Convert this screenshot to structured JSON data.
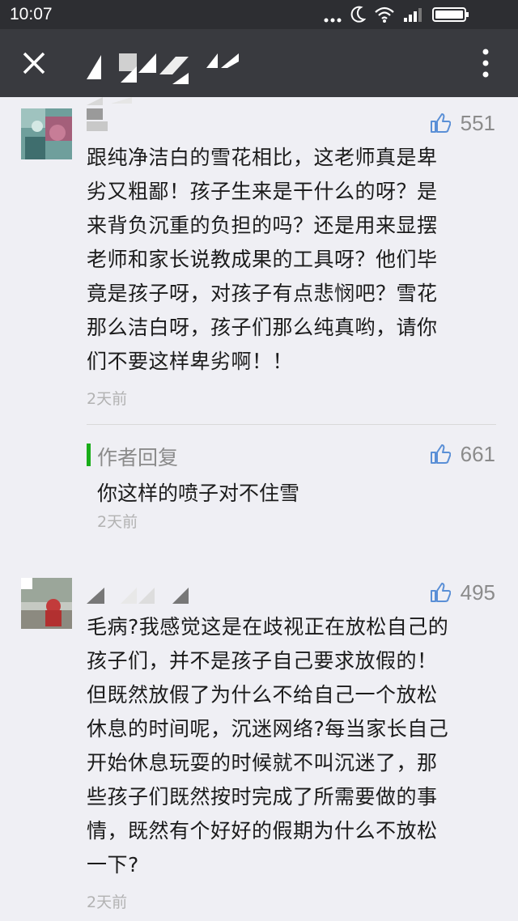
{
  "status_bar": {
    "time": "10:07",
    "icons": [
      "more-dots-icon",
      "moon-icon",
      "wifi-icon",
      "signal-icon",
      "battery-icon"
    ]
  },
  "nav": {
    "close_icon": "close-icon",
    "more_icon": "more-vertical-icon",
    "title_obscured": true
  },
  "colors": {
    "status_bar_bg": "#2d2e32",
    "nav_bg": "#393a3f",
    "page_bg": "#efeff4",
    "reply_accent": "#19ad19",
    "meta_gray": "#8b8b8b"
  },
  "comments": [
    {
      "likes": "551",
      "text": "跟纯净洁白的雪花相比，这老师真是卑劣又粗鄙！孩子生来是干什么的呀？是来背负沉重的负担的吗？还是用来显摆老师和家长说教成果的工具呀？他们毕竟是孩子呀，对孩子有点悲悯吧？雪花那么洁白呀，孩子们那么纯真哟，请你们不要这样卑劣啊！！",
      "lines": [
        "跟纯净洁白的雪花相比，这老师真是卑",
        "劣又粗鄙！孩子生来是干什么的呀？是",
        "来背负沉重的负担的吗？还是用来显摆",
        "老师和家长说教成果的工具呀？他们毕",
        "竟是孩子呀，对孩子有点悲悯吧？雪花",
        "那么洁白呀，孩子们那么纯真哟，请你",
        "们不要这样卑劣啊！！"
      ],
      "time": "2天前",
      "reply": {
        "label": "作者回复",
        "likes": "661",
        "text": "你这样的喷子对不住雪",
        "time": "2天前"
      }
    },
    {
      "likes": "495",
      "lines": [
        "毛病?我感觉这是在歧视正在放松自己的",
        "孩子们，并不是孩子自己要求放假的！",
        "但既然放假了为什么不给自己一个放松",
        "休息的时间呢，沉迷网络?每当家长自己",
        "开始休息玩耍的时候就不叫沉迷了，那",
        "些孩子们既然按时完成了所需要做的事",
        "情，既然有个好好的假期为什么不放松",
        "一下?"
      ],
      "time": "2天前"
    }
  ]
}
